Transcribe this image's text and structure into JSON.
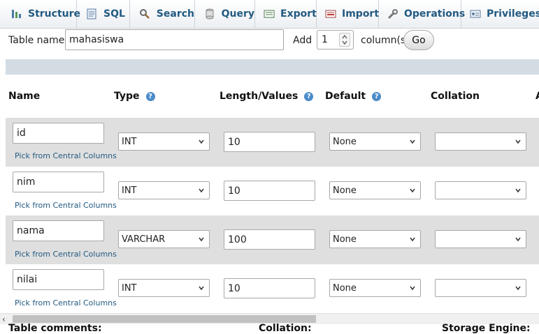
{
  "tabs": [
    {
      "label": "Structure",
      "icon": "structure-icon"
    },
    {
      "label": "SQL",
      "icon": "sql-icon"
    },
    {
      "label": "Search",
      "icon": "search-icon"
    },
    {
      "label": "Query",
      "icon": "query-icon"
    },
    {
      "label": "Export",
      "icon": "export-icon"
    },
    {
      "label": "Import",
      "icon": "import-icon"
    },
    {
      "label": "Operations",
      "icon": "wrench-icon"
    },
    {
      "label": "Privileges",
      "icon": "privileges-icon"
    }
  ],
  "form": {
    "table_name_label": "Table name:",
    "table_name_value": "mahasiswa",
    "add_label": "Add",
    "add_count": "1",
    "columns_label": "column(s)",
    "go_label": "Go"
  },
  "headers": {
    "name": "Name",
    "type": "Type",
    "length": "Length/Values",
    "default": "Default",
    "collation": "Collation",
    "attributes_cut": "A"
  },
  "pick_label": "Pick from Central Columns",
  "columns": [
    {
      "name": "id",
      "type": "INT",
      "length": "10",
      "default": "None",
      "collation": ""
    },
    {
      "name": "nim",
      "type": "INT",
      "length": "10",
      "default": "None",
      "collation": ""
    },
    {
      "name": "nama",
      "type": "VARCHAR",
      "length": "100",
      "default": "None",
      "collation": ""
    },
    {
      "name": "nilai",
      "type": "INT",
      "length": "10",
      "default": "None",
      "collation": ""
    }
  ],
  "bottom_partial": {
    "left": "Table comments:",
    "mid": "Collation:",
    "right": "Storage Engine:"
  }
}
